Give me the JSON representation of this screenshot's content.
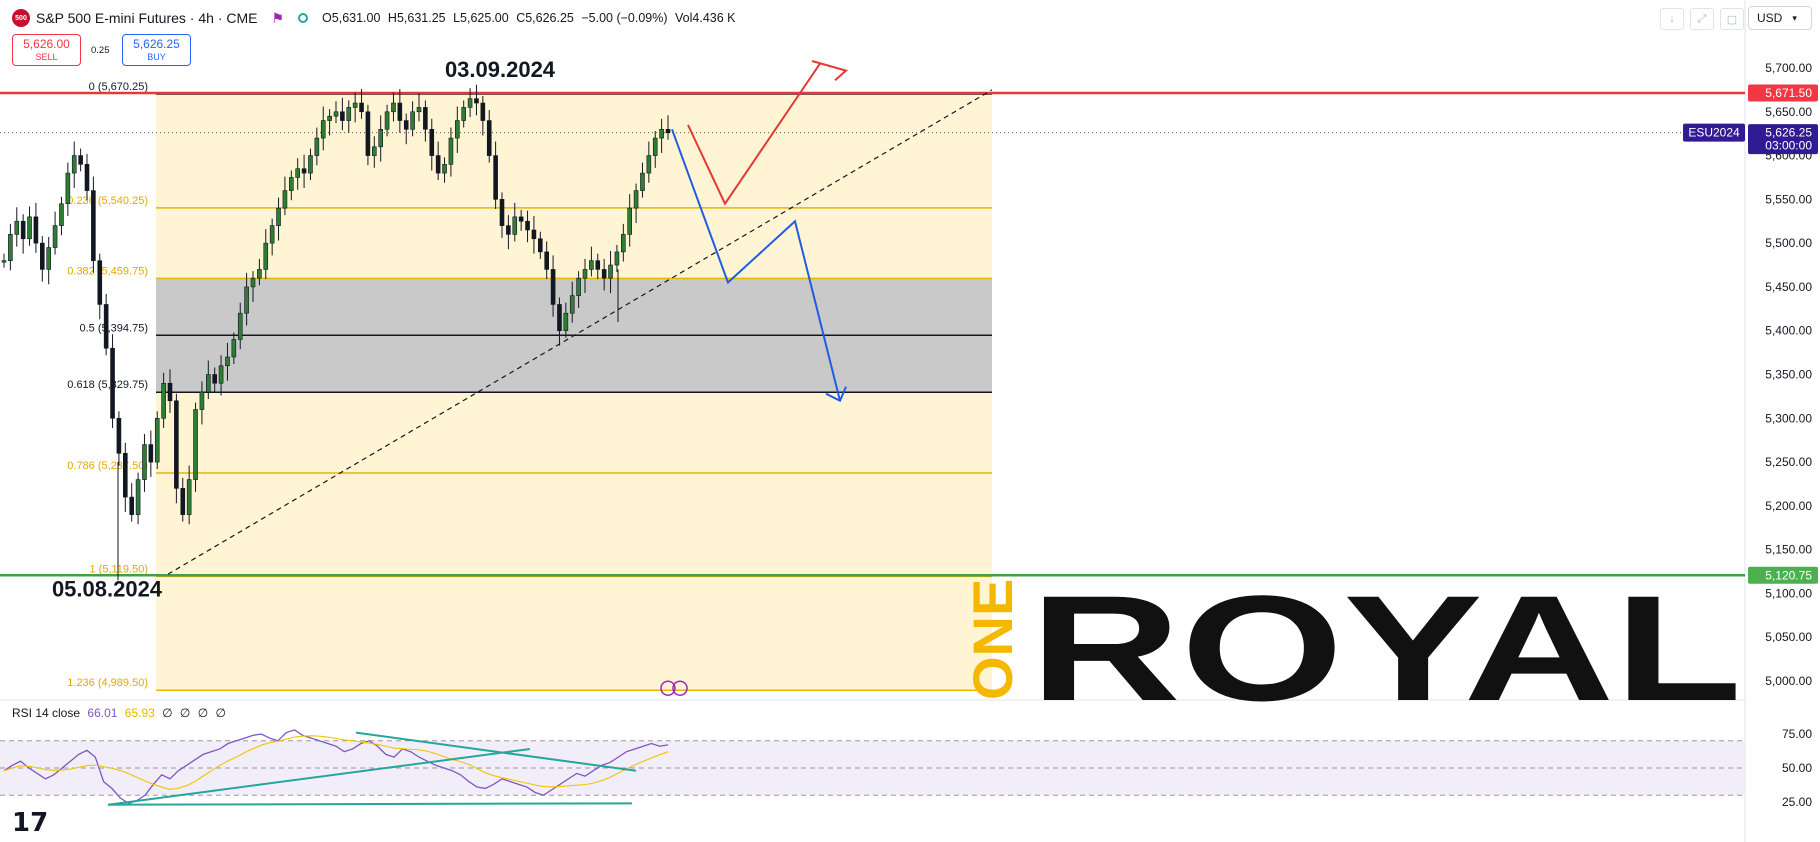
{
  "header": {
    "symbol_icon": "500",
    "title": "S&P 500 E-mini Futures · 4h · CME",
    "ohlc": {
      "open": "O5,631.00",
      "high": "H5,631.25",
      "low": "L5,625.00",
      "close": "C5,626.25",
      "change": "−5.00 (−0.09%)",
      "volume": "Vol4.436 K"
    },
    "currency": "USD",
    "flag_icon": "flag-icon",
    "status_icon": "market-status-icon"
  },
  "trade": {
    "sell_price": "5,626.00",
    "sell_label": "SELL",
    "spread": "0.25",
    "buy_price": "5,626.25",
    "buy_label": "BUY"
  },
  "chart_data": {
    "type": "candlestick",
    "symbol": "ESU2024",
    "timeframe": "4h",
    "ylim": [
      4990,
      5720
    ],
    "y_ticks": [
      "5,700.00",
      "5,650.00",
      "5,600.00",
      "5,550.00",
      "5,500.00",
      "5,450.00",
      "5,400.00",
      "5,350.00",
      "5,300.00",
      "5,250.00",
      "5,200.00",
      "5,150.00",
      "5,100.00",
      "5,050.00",
      "5,000.00"
    ],
    "y_tick_values": [
      5700,
      5650,
      5600,
      5550,
      5500,
      5450,
      5400,
      5350,
      5300,
      5250,
      5200,
      5150,
      5100,
      5050,
      5000
    ],
    "annotations": {
      "top_date": "03.09.2024",
      "bottom_date": "05.08.2024"
    },
    "price_labels": [
      {
        "text": "5,671.50",
        "value": 5671.5,
        "color": "#f23645"
      },
      {
        "text": "5,626.25",
        "sub": "03:00:00",
        "value": 5626.25,
        "color": "#311b92"
      },
      {
        "text": "5,120.75",
        "value": 5120.75,
        "color": "#4caf50"
      }
    ],
    "symbol_tag": "ESU2024",
    "fibonacci": [
      {
        "level": "0",
        "price": "(5,670.25)",
        "value": 5670.25
      },
      {
        "level": "0.236",
        "price": "(5,540.25)",
        "value": 5540.25
      },
      {
        "level": "0.382",
        "price": "(5,459.75)",
        "value": 5459.75
      },
      {
        "level": "0.5",
        "price": "(5,394.75)",
        "value": 5394.75
      },
      {
        "level": "0.618",
        "price": "(5,329.75)",
        "value": 5329.75
      },
      {
        "level": "0.786",
        "price": "(5,237.50)",
        "value": 5237.5
      },
      {
        "level": "1",
        "price": "(5,119.50)",
        "value": 5119.5
      },
      {
        "level": "1.236",
        "price": "(4,989.50)",
        "value": 4989.5
      }
    ],
    "series": [
      {
        "values": [
          5480,
          5510,
          5525,
          5505,
          5530,
          5500,
          5470,
          5495,
          5520,
          5545,
          5580,
          5600,
          5590,
          5560,
          5480,
          5430,
          5380,
          5300,
          5260,
          5210,
          5190,
          5230,
          5270,
          5250,
          5300,
          5340,
          5320,
          5220,
          5190,
          5230,
          5310,
          5330,
          5350,
          5340,
          5360,
          5370,
          5390,
          5420,
          5450,
          5460,
          5470,
          5500,
          5520,
          5540,
          5560,
          5575,
          5585,
          5580,
          5600,
          5620,
          5640,
          5645,
          5650,
          5640,
          5655,
          5660,
          5650,
          5600,
          5610,
          5630,
          5650,
          5660,
          5640,
          5630,
          5650,
          5655,
          5630,
          5600,
          5580,
          5590,
          5620,
          5640,
          5655,
          5665,
          5660,
          5640,
          5600,
          5550,
          5520,
          5510,
          5530,
          5525,
          5515,
          5505,
          5490,
          5470,
          5430,
          5400,
          5420,
          5440,
          5460,
          5470,
          5480,
          5470,
          5460,
          5475,
          5490,
          5510,
          5540,
          5560,
          5580,
          5600,
          5620,
          5630,
          5626
        ]
      }
    ]
  },
  "rsi": {
    "label": "RSI 14 close",
    "value1": "66.01",
    "value2": "65.93",
    "rest": "∅ ∅ ∅ ∅",
    "ticks": [
      "75.00",
      "50.00",
      "25.00"
    ],
    "tick_values": [
      75,
      50,
      25
    ],
    "ylim": [
      15,
      92
    ],
    "values": [
      48,
      52,
      55,
      50,
      46,
      42,
      45,
      50,
      55,
      60,
      63,
      58,
      40,
      35,
      28,
      24,
      26,
      30,
      38,
      45,
      42,
      48,
      52,
      56,
      60,
      62,
      64,
      68,
      70,
      72,
      74,
      75,
      72,
      70,
      76,
      78,
      74,
      72,
      70,
      68,
      66,
      62,
      64,
      68,
      70,
      66,
      60,
      58,
      64,
      62,
      58,
      55,
      52,
      50,
      48,
      45,
      40,
      36,
      35,
      38,
      42,
      40,
      38,
      36,
      32,
      30,
      34,
      38,
      42,
      46,
      44,
      48,
      52,
      54,
      58,
      62,
      64,
      66,
      68,
      66,
      67
    ]
  },
  "watermark": {
    "prefix": "ONE",
    "word": "ROYAL"
  },
  "tv_logo": "17"
}
